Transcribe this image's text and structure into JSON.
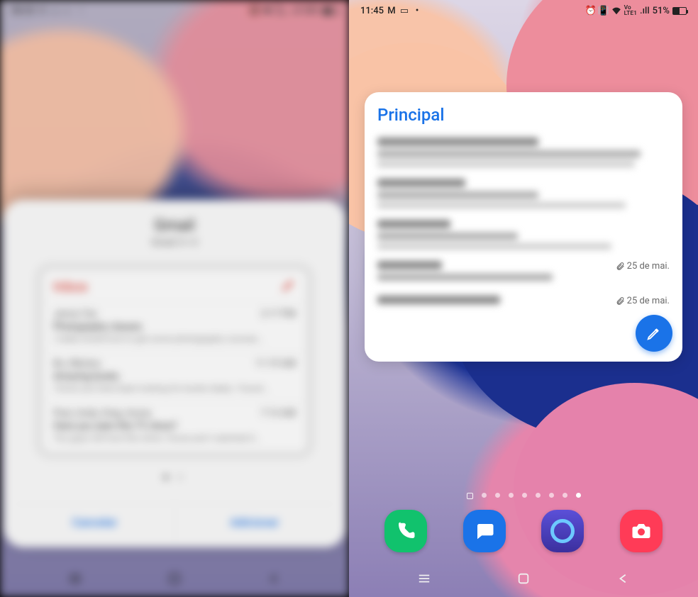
{
  "left": {
    "status": {
      "time": "08:20",
      "battery_text": "58%",
      "network_tag": "VoLTE1",
      "signal_strength": ".ıll"
    },
    "sheet": {
      "title": "Gmail",
      "subtitle": "Gmail  3 × 3",
      "inbox_label": "Inbox",
      "messages": [
        {
          "sender": "Jenna Tan",
          "time": "2:17 PM",
          "subject": "Photography classes",
          "snippet": "I really would love to get some photography courses…"
        },
        {
          "sender": "Bo, Nikolus",
          "time": "11:19 AM",
          "subject": "Amazing books",
          "snippet": "I know you have been looking for books lately. I found…"
        },
        {
          "sender": "Paul, Andy, Greg, Aruna",
          "time": "7:13 AM",
          "subject": "Have you seen this TV show?",
          "snippet": "You guys will love this show. Aruna and I watched it…"
        }
      ],
      "cancel_label": "Cancelar",
      "add_label": "Adicionar"
    }
  },
  "right": {
    "status": {
      "time": "11:45",
      "battery_text": "51%",
      "network_tag": "VoLTE1",
      "signal_strength": ".ıll"
    },
    "widget": {
      "title": "Principal",
      "rows": [
        {
          "date": ""
        },
        {
          "date": ""
        },
        {
          "date": ""
        },
        {
          "date": "25 de mai.",
          "attach": true
        },
        {
          "date": "25 de mai.",
          "attach": true
        }
      ]
    },
    "dock": {
      "apps": [
        "phone",
        "messages",
        "browser",
        "camera"
      ]
    }
  },
  "icons": {
    "pencil": "pencil-icon",
    "attach": "attachment-icon"
  },
  "colors": {
    "accent_blue": "#1a73e8",
    "gmail_red": "#d93025"
  }
}
